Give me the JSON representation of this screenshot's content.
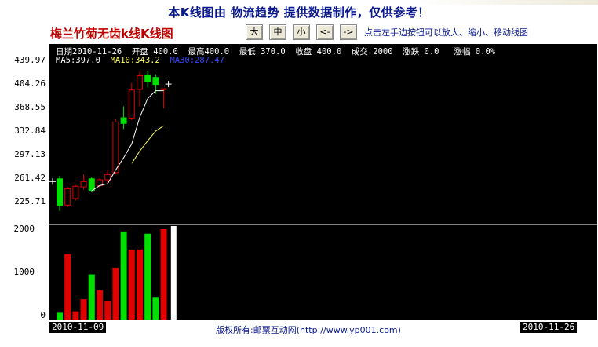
{
  "banner": "本K线图由 物流趋势 提供数据制作，仅供参考！",
  "stock_title": "梅兰竹菊无齿k线K线图",
  "nav": {
    "buttons": [
      "大",
      "中",
      "小",
      "<-",
      "->"
    ],
    "hint": "点击左手边按钮可以放大、缩小、移动线图"
  },
  "info": {
    "date_label": "日期",
    "date": "2010-11-26",
    "open_label": "开盘",
    "open": "400.0",
    "high_label": "最高",
    "high": "400.0",
    "low_label": "最低",
    "low": "370.0",
    "close_label": "收盘",
    "close": "400.0",
    "volume_label": "成交",
    "volume": "2000",
    "change_label": "涨跌",
    "change": "0.0",
    "pct_label": "涨幅",
    "pct": "0.0%",
    "ma5_label": "MA5:",
    "ma5": "397.0",
    "ma10_label": "MA10:",
    "ma10": "343.2",
    "ma30_label": "MA30:",
    "ma30": "287.47"
  },
  "dates": {
    "start": "2010-11-09",
    "end": "2010-11-26"
  },
  "copyright": "版权所有:邮票互动网(http://www.yp001.com)",
  "colors": {
    "up": "#e00000",
    "down": "#00e000",
    "background": "#000000",
    "ma5": "#ffffff",
    "ma10": "#ffff66",
    "ma30": "#3344ff"
  },
  "chart_data": {
    "type": "candlestick",
    "price_ticks": [
      "439.97",
      "404.26",
      "368.55",
      "332.84",
      "297.13",
      "261.42",
      "225.71"
    ],
    "price_ylim": [
      208,
      440
    ],
    "volume_ticks": [
      "2000",
      "1000",
      "0"
    ],
    "volume_ylim": [
      0,
      2000
    ],
    "candles": [
      {
        "o": 262,
        "h": 266,
        "l": 212,
        "c": 220
      },
      {
        "o": 221,
        "h": 249,
        "l": 218,
        "c": 246
      },
      {
        "o": 231,
        "h": 252,
        "l": 228,
        "c": 250
      },
      {
        "o": 249,
        "h": 268,
        "l": 245,
        "c": 257
      },
      {
        "o": 262,
        "h": 264,
        "l": 241,
        "c": 243
      },
      {
        "o": 251,
        "h": 262,
        "l": 248,
        "c": 260
      },
      {
        "o": 260,
        "h": 275,
        "l": 254,
        "c": 268
      },
      {
        "o": 271,
        "h": 353,
        "l": 268,
        "c": 349
      },
      {
        "o": 356,
        "h": 373,
        "l": 338,
        "c": 346
      },
      {
        "o": 355,
        "h": 409,
        "l": 352,
        "c": 398
      },
      {
        "o": 399,
        "h": 426,
        "l": 372,
        "c": 420
      },
      {
        "o": 422,
        "h": 428,
        "l": 402,
        "c": 411
      },
      {
        "o": 418,
        "h": 422,
        "l": 392,
        "c": 406
      },
      {
        "o": 400,
        "h": 400,
        "l": 370,
        "c": 400
      }
    ],
    "ma5": [
      null,
      null,
      null,
      null,
      243,
      251,
      254,
      275,
      294,
      315,
      356,
      385,
      397,
      397
    ],
    "ma10": [
      null,
      null,
      null,
      null,
      null,
      null,
      null,
      null,
      null,
      285,
      304,
      320,
      335,
      343.2
    ],
    "volume": [
      150,
      1450,
      180,
      450,
      1000,
      650,
      400,
      1150,
      1950,
      1550,
      1550,
      1900,
      500,
      2000
    ]
  }
}
